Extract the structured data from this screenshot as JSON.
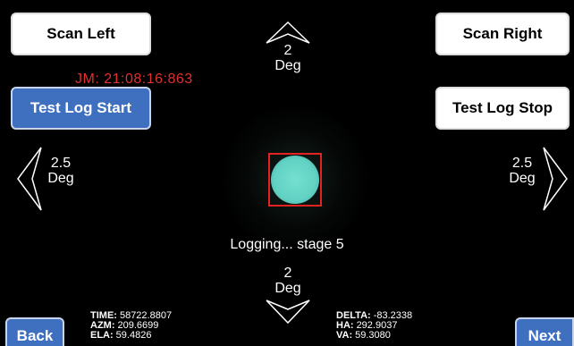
{
  "buttons": {
    "scan_left": "Scan Left",
    "scan_right": "Scan Right",
    "test_log_start": "Test Log Start",
    "test_log_stop": "Test Log Stop",
    "back": "Back",
    "next": "Next"
  },
  "timestamp": "JM: 21:08:16:863",
  "arrows": {
    "up": {
      "value": "2",
      "unit": "Deg"
    },
    "down": {
      "value": "2",
      "unit": "Deg"
    },
    "left": {
      "value": "2.5",
      "unit": "Deg"
    },
    "right": {
      "value": "2.5",
      "unit": "Deg"
    }
  },
  "status": "Logging... stage 5",
  "readouts_left": [
    {
      "key": "TIME:",
      "value": "58722.8807"
    },
    {
      "key": "AZM:",
      "value": "209.6699"
    },
    {
      "key": "ELA:",
      "value": "59.4826"
    }
  ],
  "readouts_right": [
    {
      "key": "DELTA:",
      "value": "-83.2338"
    },
    {
      "key": "HA:",
      "value": "292.9037"
    },
    {
      "key": "VA:",
      "value": "59.3080"
    }
  ],
  "colors": {
    "background": "#000000",
    "timestamp": "#e03030",
    "primary_button": "#3f6fbf",
    "target_box": "#e32222",
    "target_dot": "#62d2c4"
  },
  "icons": {
    "up": "chevron-up-icon",
    "down": "chevron-down-icon",
    "left": "chevron-left-icon",
    "right": "chevron-right-icon"
  }
}
